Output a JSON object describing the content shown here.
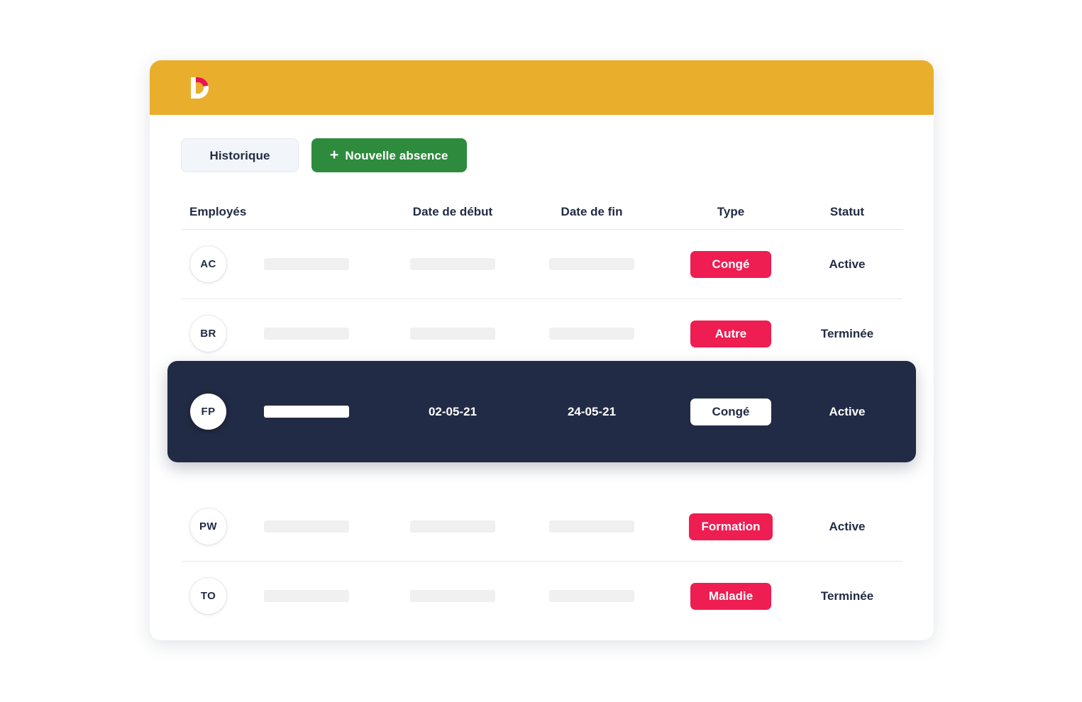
{
  "theme": {
    "header_yellow": "#E9AE2C",
    "accent_pink": "#EE1D52",
    "accent_green": "#2E8B3D",
    "navy": "#222B45",
    "skeleton_gray": "#F0F0F1"
  },
  "logo": {
    "name": "dayforce-d-logo",
    "letter": "D"
  },
  "toolbar": {
    "history_label": "Historique",
    "new_absence_plus": "+",
    "new_absence_label": "Nouvelle absence"
  },
  "table": {
    "columns": {
      "employees": "Employés",
      "start_date": "Date de début",
      "end_date": "Date de fin",
      "type": "Type",
      "status": "Statut"
    },
    "rows": [
      {
        "initials": "AC",
        "name": "",
        "start_date": "",
        "end_date": "",
        "type": "Congé",
        "status": "Active",
        "selected": false
      },
      {
        "initials": "BR",
        "name": "",
        "start_date": "",
        "end_date": "",
        "type": "Autre",
        "status": "Terminée",
        "selected": false
      },
      {
        "initials": "FP",
        "name": "",
        "start_date": "02-05-21",
        "end_date": "24-05-21",
        "type": "Congé",
        "status": "Active",
        "selected": true
      },
      {
        "initials": "PW",
        "name": "",
        "start_date": "",
        "end_date": "",
        "type": "Formation",
        "status": "Active",
        "selected": false
      },
      {
        "initials": "TO",
        "name": "",
        "start_date": "",
        "end_date": "",
        "type": "Maladie",
        "status": "Terminée",
        "selected": false
      }
    ]
  }
}
